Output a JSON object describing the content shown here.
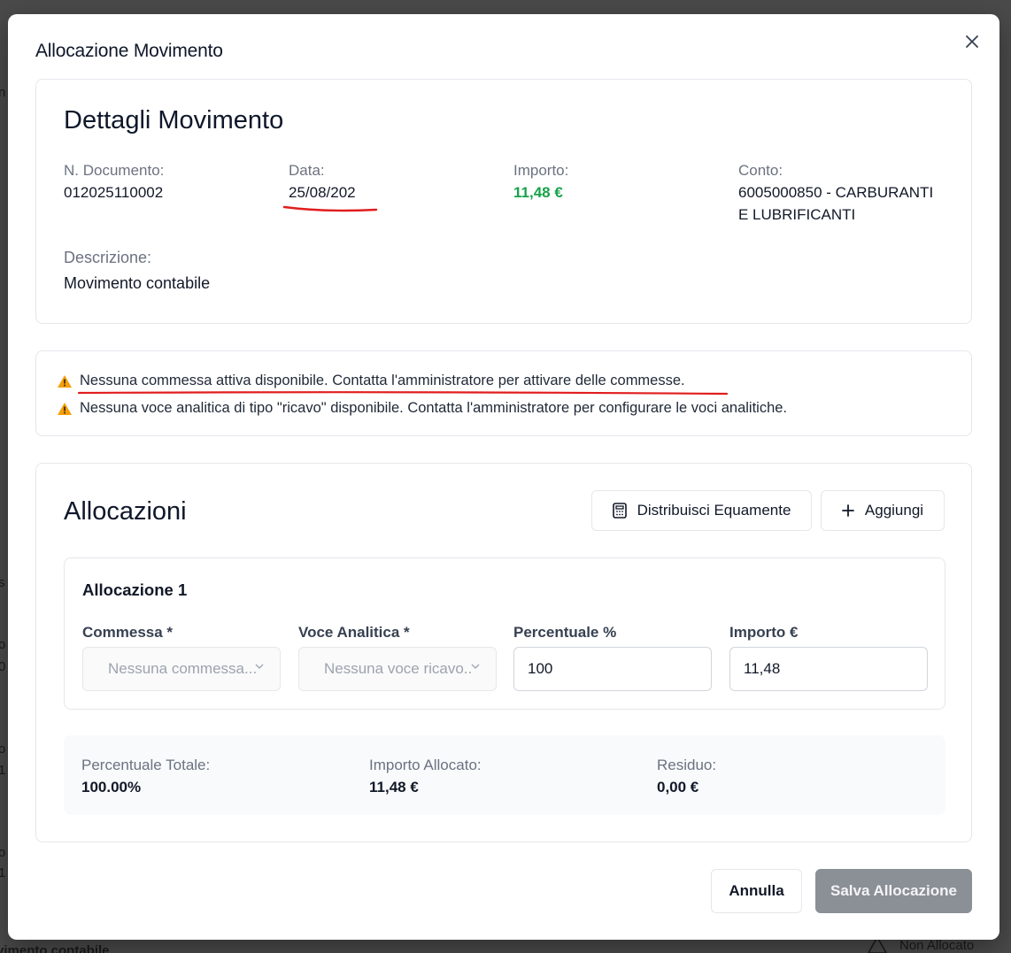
{
  "dialog": {
    "title": "Allocazione Movimento",
    "close_icon": "close-icon"
  },
  "details": {
    "title": "Dettagli Movimento",
    "doc_label": "N. Documento:",
    "doc_value": "012025110002",
    "date_label": "Data:",
    "date_value": "25/08/202",
    "amount_label": "Importo:",
    "amount_value": "11,48 €",
    "account_label": "Conto:",
    "account_value_line1": "6005000850 - CARBURANTI",
    "account_value_line2": "E LUBRIFICANTI",
    "description_label": "Descrizione:",
    "description_value": "Movimento contabile"
  },
  "warnings": [
    {
      "icon": "warning-icon",
      "text": "Nessuna commessa attiva disponibile. Contatta l'amministratore per attivare delle commesse."
    },
    {
      "icon": "warning-icon",
      "text": "Nessuna voce analitica di tipo \"ricavo\" disponibile. Contatta l'amministratore per configurare le voci analitiche."
    }
  ],
  "allocations": {
    "title": "Allocazioni",
    "distribute_label": "Distribuisci Equamente",
    "add_label": "Aggiungi",
    "items": [
      {
        "title": "Allocazione 1",
        "commessa_label": "Commessa *",
        "commessa_placeholder": "Nessuna commessa...",
        "voce_label": "Voce Analitica *",
        "voce_placeholder": "Nessuna voce ricavo..",
        "percent_label": "Percentuale %",
        "percent_value": "100",
        "amount_label": "Importo €",
        "amount_value": "11,48"
      }
    ],
    "summary": {
      "total_percent_label": "Percentuale Totale:",
      "total_percent_value": "100.00%",
      "allocated_label": "Importo Allocato:",
      "allocated_value": "11,48 €",
      "residual_label": "Residuo:",
      "residual_value": "0,00 €"
    }
  },
  "footer": {
    "cancel_label": "Annulla",
    "save_label": "Salva Allocazione"
  },
  "background": {
    "status_text": "Non Allocato",
    "bottom_text": "vimento contabile"
  },
  "colors": {
    "accent_green": "#16a34a",
    "annotation_red": "#e11d1d",
    "warning_yellow": "#f59e0b",
    "disabled_button": "#8b8f96"
  }
}
